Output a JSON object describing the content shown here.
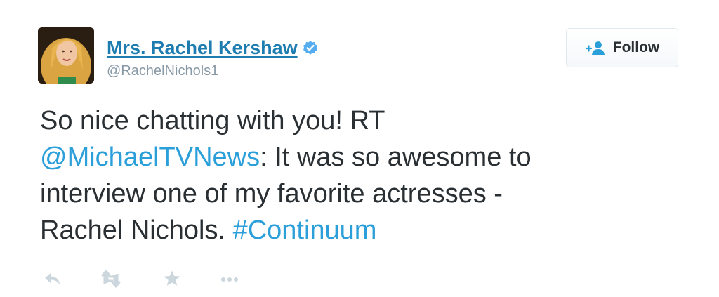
{
  "user": {
    "display_name": "Mrs. Rachel Kershaw",
    "handle": "@RachelNichols1",
    "verified_icon": "verified-badge-icon",
    "avatar": "avatar-photo"
  },
  "follow_button": {
    "label": "Follow",
    "icon": "add-user-icon"
  },
  "tweet": {
    "line1": "So nice chatting with you! RT",
    "mention": "@MichaelTVNews",
    "line2_rest": ": It was so awesome to",
    "line3": "interview one of my favorite actresses -",
    "line4_prefix": "Rachel Nichols.",
    "hashtag": "#Continuum"
  },
  "actions": [
    {
      "name": "reply",
      "icon": "reply-icon"
    },
    {
      "name": "retweet",
      "icon": "retweet-icon"
    },
    {
      "name": "favorite",
      "icon": "star-icon"
    },
    {
      "name": "more",
      "icon": "more-dots-icon"
    }
  ],
  "colors": {
    "name_link": "#1e7db0",
    "link": "#2b9fd9",
    "handle": "#8899a6",
    "text": "#292f33",
    "action_icons": "#ccd6dd",
    "verified": "#55acee"
  }
}
